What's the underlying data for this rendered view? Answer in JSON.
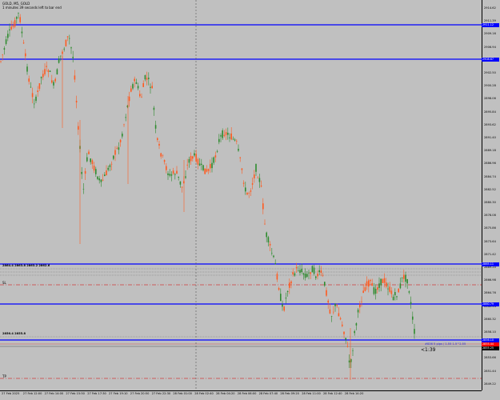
{
  "header": {
    "symbol_line": "GOLD, M5, GOLD",
    "timer_line": "1 minutes 39 seconds left to bar end"
  },
  "colors": {
    "background": "#c0c0c0",
    "bull_candle": "#2e8b2e",
    "bear_candle": "#ff5a1f",
    "hline": "#0000ff",
    "dashed_red": "#d13c3c",
    "bid_label": "#ff0000"
  },
  "price_axis": {
    "ticks": [
      "2914.62",
      "2911.39",
      "2909.16",
      "2906.94",
      "2904.79",
      "2902.50",
      "2900.28",
      "2898.06",
      "2895.84",
      "2893.62",
      "2891.40",
      "2889.18",
      "2886.96",
      "2884.74",
      "2882.52",
      "2880.30",
      "2878.08",
      "2875.86",
      "2873.64",
      "2871.42",
      "2869.20",
      "2866.98",
      "2864.76",
      "2862.54",
      "2860.32",
      "2858.10",
      "2855.88",
      "2853.66",
      "2851.44",
      "2849.22"
    ],
    "labels": [
      {
        "text": "2911.12",
        "bg": "#0000ff"
      },
      {
        "text": "2908.67",
        "bg": "#0000ff"
      },
      {
        "text": "2865.11",
        "bg": "#0000ff"
      },
      {
        "text": "2860.79",
        "bg": "#0000ff"
      },
      {
        "text": "2856.10",
        "bg": "#0000ff"
      },
      {
        "text": "2855.44",
        "bg": "#ff0000"
      },
      {
        "text": "2855.25",
        "bg": "#000000"
      }
    ]
  },
  "time_axis": {
    "ticks": [
      "27 Feb 2025",
      "27 Feb 12:00",
      "27 Feb 14:00",
      "27 Feb 15:50",
      "27 Feb 17:30",
      "27 Feb 19:10",
      "27 Feb 20:50",
      "27 Feb 22:30",
      "28 Feb 01:00",
      "28 Feb 02:40",
      "28 Feb 04:20",
      "28 Feb 06:00",
      "28 Feb 07:40",
      "28 Feb 09:20",
      "28 Feb 11:00",
      "28 Feb 12:40",
      "28 Feb 14:20"
    ]
  },
  "annotations": {
    "order_line": "#836 5 pips / 1.55 1.5^2.55",
    "countdown": "<1:39",
    "tp_tag": "TP",
    "sl_tag": "SL",
    "level_group_top": "2864.4 2863.8 2863.2 2862.6",
    "level_group_bottom": "2856.4 2855.8"
  }
}
